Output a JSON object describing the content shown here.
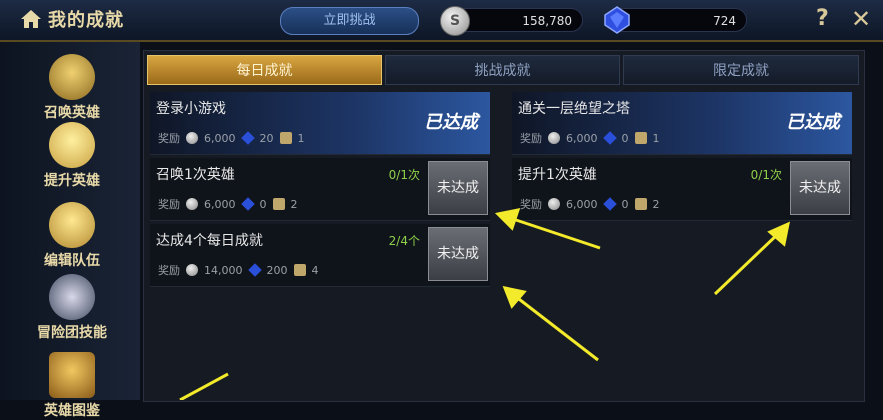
{
  "header": {
    "title": "我的成就",
    "challenge_label": "立即挑战",
    "coins": "158,780",
    "gems": "724"
  },
  "sidebar": {
    "items": [
      {
        "label": "召唤英雄",
        "icon": "pot-icon"
      },
      {
        "label": "提升英雄",
        "icon": "level-up-icon"
      },
      {
        "label": "编辑队伍",
        "icon": "team-icon"
      },
      {
        "label": "冒险团技能",
        "icon": "compass-icon"
      },
      {
        "label": "英雄图鉴",
        "icon": "book-icon"
      }
    ]
  },
  "tabs": [
    {
      "label": "每日成就",
      "active": true
    },
    {
      "label": "挑战成就",
      "active": false
    },
    {
      "label": "限定成就",
      "active": false
    }
  ],
  "reward_label": "奖励",
  "achievements_left": [
    {
      "name": "登录小游戏",
      "progress": "",
      "coin": "6,000",
      "gem": "20",
      "box": "1",
      "status": "已达成",
      "done": true
    },
    {
      "name": "召唤1次英雄",
      "progress": "0/1次",
      "coin": "6,000",
      "gem": "0",
      "box": "2",
      "status": "未达成",
      "done": false
    },
    {
      "name": "达成4个每日成就",
      "progress": "2/4个",
      "coin": "14,000",
      "gem": "200",
      "box": "4",
      "status": "未达成",
      "done": false
    }
  ],
  "achievements_right": [
    {
      "name": "通关一层绝望之塔",
      "progress": "",
      "coin": "6,000",
      "gem": "0",
      "box": "1",
      "status": "已达成",
      "done": true
    },
    {
      "name": "提升1次英雄",
      "progress": "0/1次",
      "coin": "6,000",
      "gem": "0",
      "box": "2",
      "status": "未达成",
      "done": false
    }
  ],
  "colors": {
    "active_tab": "#d8a640",
    "done_card": "#2c57a0",
    "progress": "#8ed04a",
    "arrow": "#f2ea2a"
  }
}
